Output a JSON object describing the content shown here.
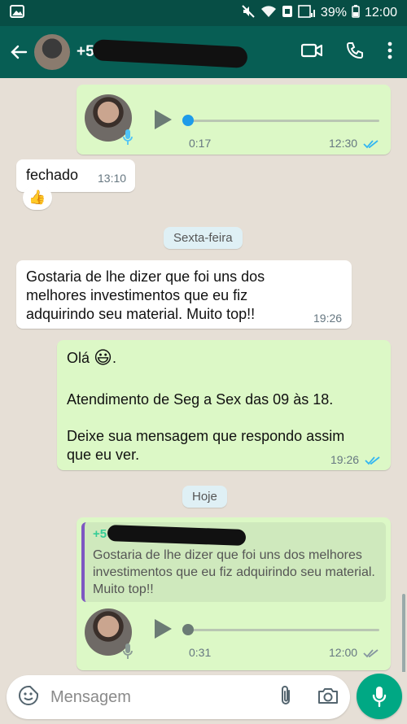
{
  "statusbar": {
    "battery": "39%",
    "clock": "12:00"
  },
  "appbar": {
    "contact_visible_prefix": "+55 1",
    "back_icon": "arrow-left-icon",
    "video_icon": "video-camera-icon",
    "call_icon": "phone-icon",
    "menu_icon": "more-vertical-icon"
  },
  "messages": {
    "voice1": {
      "duration": "0:17",
      "time": "12:30",
      "progress": 0.0
    },
    "fechado": {
      "text": "fechado",
      "time": "13:10",
      "reaction": "👍"
    },
    "date1": "Sexta-feira",
    "incoming1": {
      "line1": "Gostaria de lhe dizer que foi uns dos",
      "line2": "melhores investimentos que eu fiz",
      "line3": "adquirindo seu material. Muito top!!",
      "time": "19:26"
    },
    "auto_reply": {
      "greeting": "Olá",
      "emoji": "😃",
      "dot": ".",
      "hours": "Atendimento de Seg a Sex das 09 às 18.",
      "line_a": "Deixe sua mensagem que respondo assim",
      "line_b": "que eu ver.",
      "time": "19:26"
    },
    "date2": "Hoje",
    "reply": {
      "quote_prefix": "+5",
      "quote_text": "Gostaria de lhe dizer que foi uns dos melhores investimentos que eu fiz adquirindo seu material. Muito top!!",
      "duration": "0:31",
      "time": "12:00",
      "progress": 0.0
    }
  },
  "composer": {
    "placeholder": "Mensagem"
  },
  "colors": {
    "header": "#075e54",
    "outgoing": "#dcf8c6",
    "incoming": "#ffffff",
    "read_ticks": "#34b7f1",
    "accent": "#00a884"
  }
}
